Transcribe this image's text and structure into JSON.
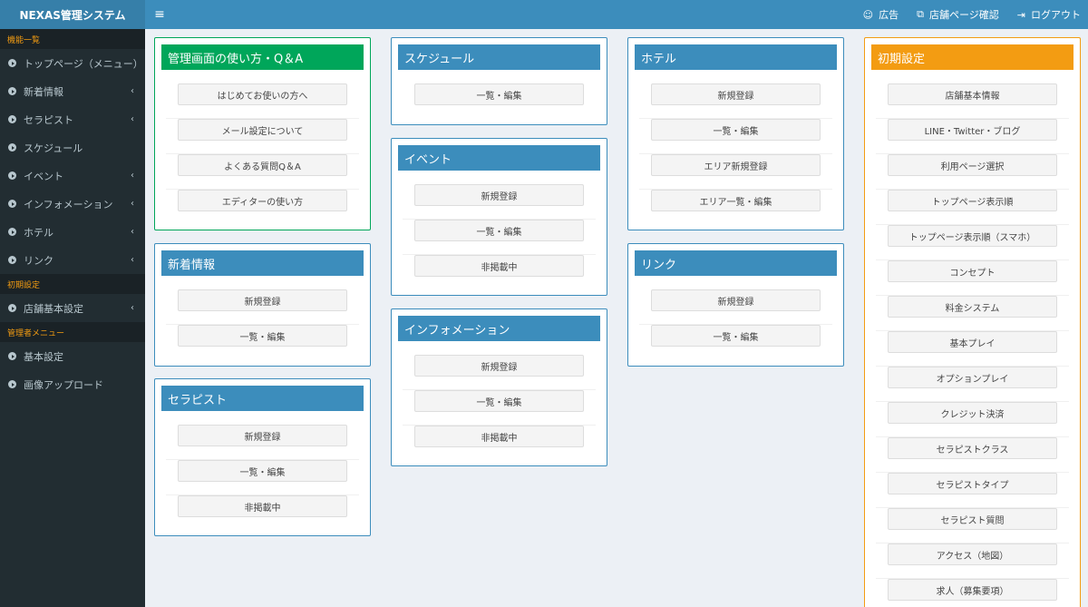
{
  "app": {
    "title": "NEXAS管理システム"
  },
  "topbar": {
    "links": [
      {
        "icon": "smile-icon",
        "label": "広告"
      },
      {
        "icon": "external-link-icon",
        "label": "店舗ページ確認"
      },
      {
        "icon": "sign-out-icon",
        "label": "ログアウト"
      }
    ]
  },
  "sidebar": {
    "section1": "機能一覧",
    "items1": [
      {
        "label": "トップページ（メニュー）",
        "chevron": ""
      },
      {
        "label": "新着情報",
        "chevron": "‹"
      },
      {
        "label": "セラピスト",
        "chevron": "‹"
      },
      {
        "label": "スケジュール",
        "chevron": ""
      },
      {
        "label": "イベント",
        "chevron": "‹"
      },
      {
        "label": "インフォメーション",
        "chevron": "‹"
      },
      {
        "label": "ホテル",
        "chevron": "‹"
      },
      {
        "label": "リンク",
        "chevron": "‹"
      }
    ],
    "section2": "初期設定",
    "items2": [
      {
        "label": "店舗基本設定",
        "chevron": "‹"
      }
    ],
    "section3": "管理者メニュー",
    "items3": [
      {
        "label": "基本設定",
        "chevron": ""
      },
      {
        "label": "画像アップロード",
        "chevron": ""
      }
    ]
  },
  "boxes": {
    "howto": {
      "title": "管理画面の使い方・Q＆A",
      "buttons": [
        "はじめてお使いの方へ",
        "メール設定について",
        "よくある質問Q＆A",
        "エディターの使い方"
      ]
    },
    "news": {
      "title": "新着情報",
      "buttons": [
        "新規登録",
        "一覧・編集"
      ]
    },
    "therapist": {
      "title": "セラピスト",
      "buttons": [
        "新規登録",
        "一覧・編集",
        "非掲載中"
      ]
    },
    "schedule": {
      "title": "スケジュール",
      "buttons": [
        "一覧・編集"
      ]
    },
    "event": {
      "title": "イベント",
      "buttons": [
        "新規登録",
        "一覧・編集",
        "非掲載中"
      ]
    },
    "information": {
      "title": "インフォメーション",
      "buttons": [
        "新規登録",
        "一覧・編集",
        "非掲載中"
      ]
    },
    "hotel": {
      "title": "ホテル",
      "buttons": [
        "新規登録",
        "一覧・編集",
        "エリア新規登録",
        "エリア一覧・編集"
      ]
    },
    "link": {
      "title": "リンク",
      "buttons": [
        "新規登録",
        "一覧・編集"
      ]
    },
    "initial": {
      "title": "初期設定",
      "buttons": [
        "店舗基本情報",
        "LINE・Twitter・ブログ",
        "利用ページ選択",
        "トップページ表示順",
        "トップページ表示順（スマホ）",
        "コンセプト",
        "料金システム",
        "基本プレイ",
        "オプションプレイ",
        "クレジット決済",
        "セラピストクラス",
        "セラピストタイプ",
        "セラピスト質問",
        "アクセス（地図）",
        "求人（募集要項）"
      ]
    }
  }
}
